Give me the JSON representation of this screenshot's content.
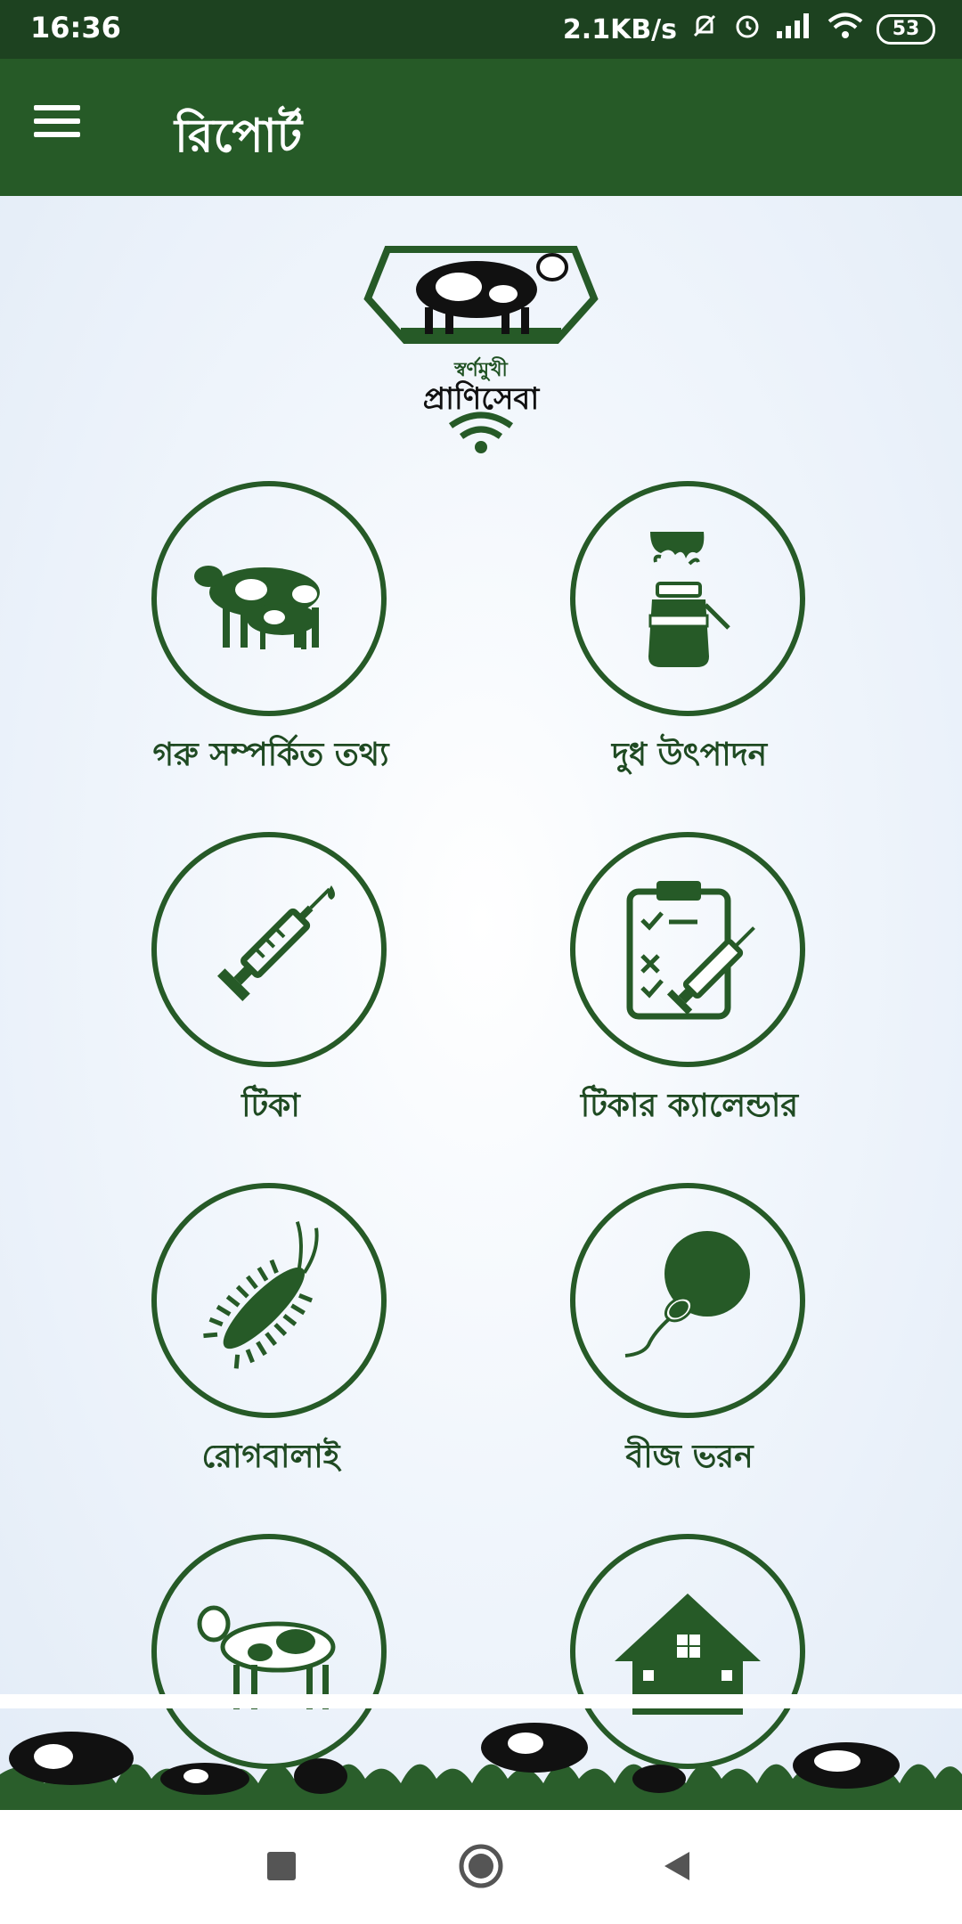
{
  "status_bar": {
    "time": "16:36",
    "net_speed": "2.1KB/s",
    "battery": "53"
  },
  "app_bar": {
    "title": "রিপোর্ট",
    "menu_icon": "hamburger-menu-icon"
  },
  "logo": {
    "brand_top": "স্বর্ণমুখী",
    "brand_name": "প্রাণিসেবা"
  },
  "tiles": [
    {
      "label": "গরু সম্পর্কিত তথ্য",
      "icon": "cows-icon"
    },
    {
      "label": "দুধ উৎপাদন",
      "icon": "milk-can-icon"
    },
    {
      "label": "টিকা",
      "icon": "syringe-icon"
    },
    {
      "label": "টিকার ক্যালেন্ডার",
      "icon": "vaccine-calendar-icon"
    },
    {
      "label": "রোগবালাই",
      "icon": "bacteria-icon"
    },
    {
      "label": "বীজ ভরন",
      "icon": "sperm-egg-icon"
    },
    {
      "label": "",
      "icon": "cow-icon"
    },
    {
      "label": "",
      "icon": "farm-house-icon"
    }
  ],
  "colors": {
    "status_bar": "#1d4220",
    "app_bar": "#265a27",
    "accent": "#265a27"
  },
  "nav_bar": {
    "recent": "square-recent-icon",
    "home": "circle-home-icon",
    "back": "triangle-back-icon"
  }
}
